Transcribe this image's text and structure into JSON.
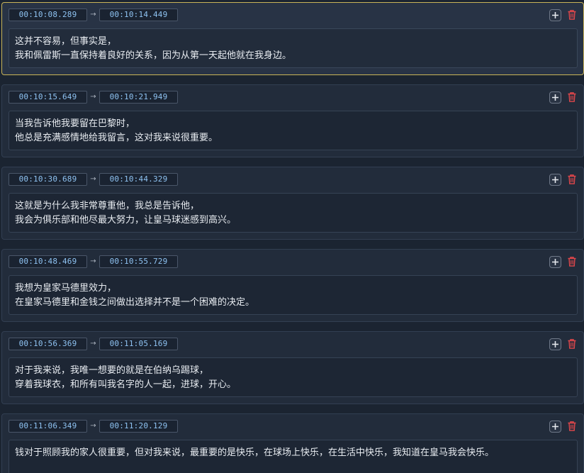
{
  "arrow_symbol": "→",
  "icons": {
    "add": "plus-icon",
    "delete": "trash-icon"
  },
  "colors": {
    "active_border": "#c9b458",
    "time_text": "#8fc3f2",
    "delete_red": "#e2474b"
  },
  "entries": [
    {
      "start": "00:10:08.289",
      "end": "00:10:14.449",
      "text": "这并不容易，但事实是，\n我和佩雷斯一直保持着良好的关系，因为从第一天起他就在我身边。",
      "active": true
    },
    {
      "start": "00:10:15.649",
      "end": "00:10:21.949",
      "text": "当我告诉他我要留在巴黎时，\n他总是充满感情地给我留言，这对我来说很重要。"
    },
    {
      "start": "00:10:30.689",
      "end": "00:10:44.329",
      "text": "这就是为什么我非常尊重他，我总是告诉他，\n我会为俱乐部和他尽最大努力，让皇马球迷感到高兴。"
    },
    {
      "start": "00:10:48.469",
      "end": "00:10:55.729",
      "text": "我想为皇家马德里效力，\n在皇家马德里和金钱之间做出选择并不是一个困难的决定。"
    },
    {
      "start": "00:10:56.369",
      "end": "00:11:05.169",
      "text": "对于我来说，我唯一想要的就是在伯纳乌踢球，\n穿着我球衣，和所有叫我名字的人一起，进球，开心。"
    },
    {
      "start": "00:11:06.349",
      "end": "00:11:20.129",
      "text": "钱对于照顾我的家人很重要，但对我来说，最重要的是快乐，在球场上快乐，在生活中快乐，我知道在皇马我会快乐。"
    }
  ]
}
